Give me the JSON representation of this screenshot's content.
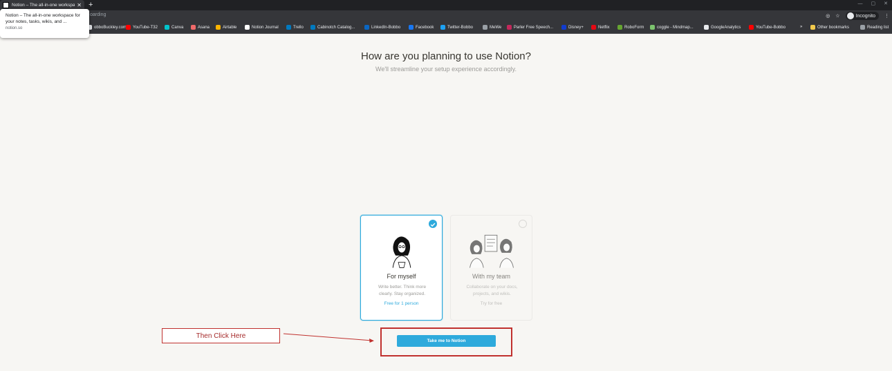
{
  "browser": {
    "tab_title": "Notion – The all-in-one workspac",
    "url_fragment": "oarding",
    "incognito_label": "Incognito",
    "bookmarks": [
      {
        "label": "obboBuckley.com",
        "color": "#e8eaed"
      },
      {
        "label": "YouTube-T32",
        "color": "#ff0000"
      },
      {
        "label": "Canva",
        "color": "#00c4cc"
      },
      {
        "label": "Asana",
        "color": "#f06a6a"
      },
      {
        "label": "Airtable",
        "color": "#fcb400"
      },
      {
        "label": "Notion Journal",
        "color": "#ffffff"
      },
      {
        "label": "Trello",
        "color": "#0079bf"
      },
      {
        "label": "Cabinotch Catalog...",
        "color": "#0079bf"
      },
      {
        "label": "LinkedIn-Bobbo",
        "color": "#0a66c2"
      },
      {
        "label": "Facebook",
        "color": "#1877f2"
      },
      {
        "label": "Twitter-Bobbo",
        "color": "#1da1f2"
      },
      {
        "label": "MeWe",
        "color": "#9aa0a6"
      },
      {
        "label": "Parler Free Speech...",
        "color": "#c4285b"
      },
      {
        "label": "Disney+",
        "color": "#113ccf"
      },
      {
        "label": "Netflix",
        "color": "#e50914"
      },
      {
        "label": "RoboForm",
        "color": "#66a531"
      },
      {
        "label": "coggle - Mindmap...",
        "color": "#7cc36e"
      },
      {
        "label": "GoogleAnalytics",
        "color": "#e8eaed"
      },
      {
        "label": "YouTube-Bobbo",
        "color": "#ff0000"
      }
    ],
    "overflow_label": "»",
    "other_bookmarks": "Other bookmarks",
    "reading_list": "Reading list"
  },
  "tooltip": {
    "line1": "Notion – The all-in-one workspace for your notes, tasks, wikis, and ...",
    "line2": "notion.so"
  },
  "page": {
    "heading": "How are you planning to use Notion?",
    "subheading": "We'll streamline your setup experience accordingly.",
    "options": [
      {
        "title": "For myself",
        "description": "Write better. Think more clearly. Stay organized.",
        "price": "Free for 1 person",
        "selected": true
      },
      {
        "title": "With my team",
        "description": "Collaborate on your docs, projects, and wikis.",
        "price": "Try for free",
        "selected": false
      }
    ],
    "cta_label": "Take me to Notion"
  },
  "annotation": {
    "label": "Then Click Here",
    "color": "#c0302d"
  },
  "colors": {
    "accent": "#2eaadc",
    "page_bg": "#f7f6f3"
  }
}
